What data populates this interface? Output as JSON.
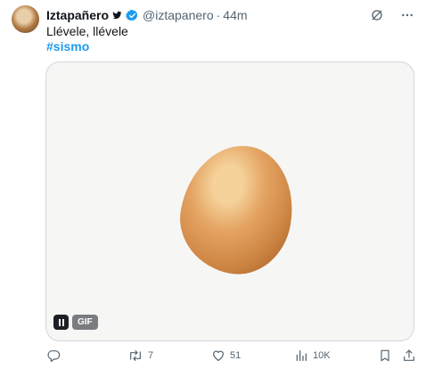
{
  "tweet": {
    "display_name": "Iztapañero",
    "handle": "@iztapanero",
    "separator": "·",
    "time": "44m",
    "text": "Llévele, llévele",
    "hashtag": "#sismo"
  },
  "media": {
    "gif_label": "GIF"
  },
  "actions": {
    "replies": "",
    "retweets": "7",
    "likes": "51",
    "views": "10K"
  },
  "colors": {
    "accent": "#1d9bf0",
    "secondary_text": "#536471",
    "border": "#cfd9de"
  },
  "icons": [
    "verified-badge-icon",
    "grok-icon",
    "more-icon",
    "reply-icon",
    "retweet-icon",
    "like-icon",
    "views-icon",
    "bookmark-icon",
    "share-icon",
    "pause-icon"
  ]
}
